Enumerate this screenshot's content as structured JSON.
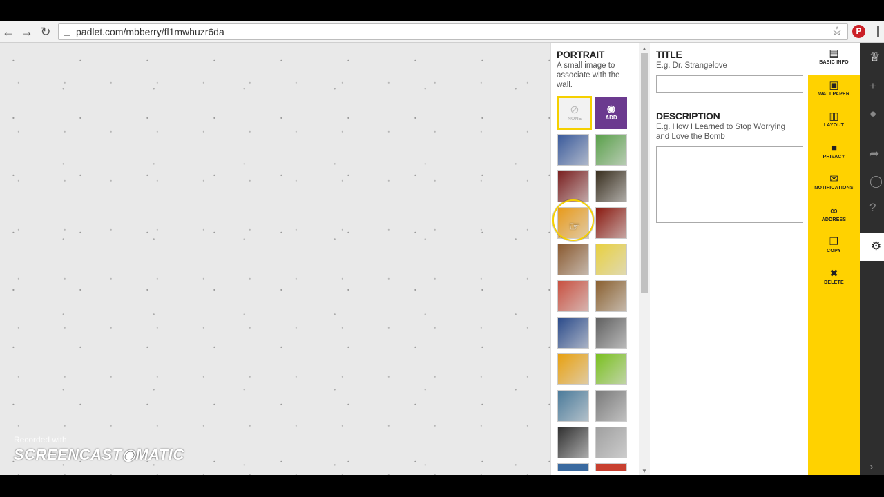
{
  "browser": {
    "back_icon": "arrow-left-icon",
    "forward_icon": "arrow-right-icon",
    "reload_icon": "reload-icon",
    "url": "padlet.com/mbberry/fl1mwhuzr6da"
  },
  "watermark": {
    "line1": "Recorded with",
    "line2": "SCREENCAST◉MATIC"
  },
  "portrait": {
    "heading": "PORTRAIT",
    "hint": "A small image to associate with the wall.",
    "none_label": "NONE",
    "add_label": "ADD",
    "thumbnail_colors": [
      [
        "#3a5a9b",
        "#5aa04a"
      ],
      [
        "#7a2020",
        "#3a3020"
      ],
      [
        "#e89a1a",
        "#8a1a10"
      ],
      [
        "#8a5a30",
        "#e8d040"
      ],
      [
        "#c85040",
        "#8a6030"
      ],
      [
        "#2a4a8a",
        "#606060"
      ],
      [
        "#e8a010",
        "#7ac020"
      ],
      [
        "#4a7a9a",
        "#7a7a7a"
      ],
      [
        "#303030",
        "#a0a0a0"
      ]
    ]
  },
  "info": {
    "title_heading": "TITLE",
    "title_placeholder": "E.g. Dr. Strangelove",
    "description_heading": "DESCRIPTION",
    "description_placeholder": "E.g. How I Learned to Stop Worrying and Love the Bomb"
  },
  "nav": [
    {
      "label": "BASIC INFO",
      "icon": "id-card-icon"
    },
    {
      "label": "WALLPAPER",
      "icon": "image-icon"
    },
    {
      "label": "LAYOUT",
      "icon": "layout-icon"
    },
    {
      "label": "PRIVACY",
      "icon": "lock-icon"
    },
    {
      "label": "NOTIFICATIONS",
      "icon": "envelope-icon"
    },
    {
      "label": "ADDRESS",
      "icon": "link-icon"
    },
    {
      "label": "COPY",
      "icon": "copy-icon"
    },
    {
      "label": "DELETE",
      "icon": "trash-icon"
    }
  ],
  "colors": {
    "accent": "#ffd200",
    "add_button": "#6b3a8f",
    "rail": "#2e2e2e"
  }
}
